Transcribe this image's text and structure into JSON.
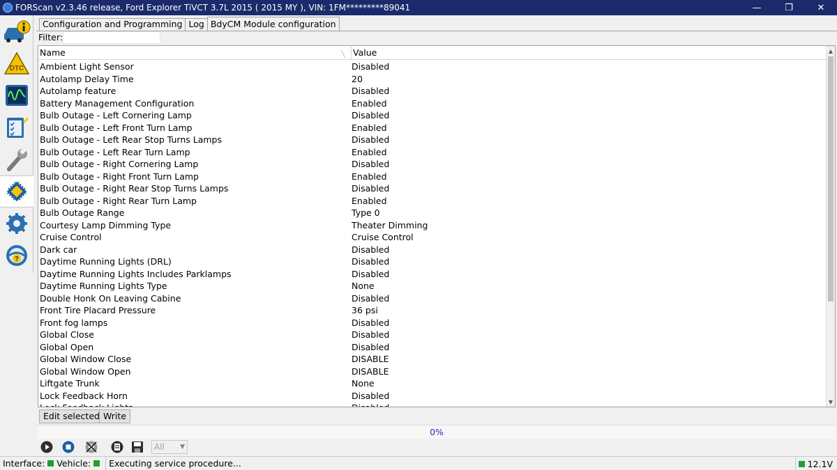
{
  "window": {
    "title": "FORScan v2.3.46 release, Ford Explorer TiVCT 3.7L 2015 ( 2015 MY ), VIN: 1FM*********89041",
    "minimize_glyph": "—",
    "maximize_glyph": "❐",
    "close_glyph": "✕"
  },
  "left_toolbar": {
    "items": [
      {
        "name": "vehicle-info-icon",
        "label": ""
      },
      {
        "name": "dtc-icon",
        "label": "DTC"
      },
      {
        "name": "oscilloscope-icon",
        "label": ""
      },
      {
        "name": "checklist-icon",
        "label": ""
      },
      {
        "name": "wrench-icon",
        "label": ""
      },
      {
        "name": "chip-icon",
        "label": ""
      },
      {
        "name": "gear-icon",
        "label": ""
      },
      {
        "name": "help-icon",
        "label": "?"
      }
    ],
    "active_index": 5
  },
  "tabs": [
    {
      "label": "Configuration and Programming"
    },
    {
      "label": "Log"
    },
    {
      "label": "BdyCM Module configuration"
    }
  ],
  "filter": {
    "label": "Filter:",
    "value": ""
  },
  "grid": {
    "columns": {
      "name": "Name",
      "value": "Value"
    },
    "rows": [
      {
        "name": "Ambient Light Sensor",
        "value": "Disabled"
      },
      {
        "name": "Autolamp Delay Time",
        "value": "20"
      },
      {
        "name": "Autolamp feature",
        "value": "Disabled"
      },
      {
        "name": "Battery Management Configuration",
        "value": "Enabled"
      },
      {
        "name": "Bulb Outage - Left Cornering Lamp",
        "value": "Disabled"
      },
      {
        "name": "Bulb Outage - Left Front Turn Lamp",
        "value": "Enabled"
      },
      {
        "name": "Bulb Outage - Left Rear Stop Turns Lamps",
        "value": "Disabled"
      },
      {
        "name": "Bulb Outage - Left Rear Turn Lamp",
        "value": "Enabled"
      },
      {
        "name": "Bulb Outage - Right Cornering Lamp",
        "value": "Disabled"
      },
      {
        "name": "Bulb Outage - Right Front Turn Lamp",
        "value": "Enabled"
      },
      {
        "name": "Bulb Outage - Right Rear Stop Turns Lamps",
        "value": "Disabled"
      },
      {
        "name": "Bulb Outage - Right Rear Turn Lamp",
        "value": "Enabled"
      },
      {
        "name": "Bulb Outage Range",
        "value": "Type 0"
      },
      {
        "name": "Courtesy Lamp Dimming Type",
        "value": "Theater Dimming"
      },
      {
        "name": "Cruise Control",
        "value": "Cruise Control"
      },
      {
        "name": "Dark car",
        "value": "Disabled"
      },
      {
        "name": "Daytime Running Lights (DRL)",
        "value": "Disabled"
      },
      {
        "name": "Daytime Running Lights Includes Parklamps",
        "value": "Disabled"
      },
      {
        "name": "Daytime Running Lights Type",
        "value": "None"
      },
      {
        "name": "Double Honk On Leaving Cabine",
        "value": "Disabled"
      },
      {
        "name": "Front Tire Placard Pressure",
        "value": "36 psi"
      },
      {
        "name": "Front fog lamps",
        "value": "Disabled"
      },
      {
        "name": "Global Close",
        "value": "Disabled"
      },
      {
        "name": "Global Open",
        "value": "Disabled"
      },
      {
        "name": "Global Window Close",
        "value": "DISABLE"
      },
      {
        "name": "Global Window Open",
        "value": "DISABLE"
      },
      {
        "name": "Liftgate Trunk",
        "value": "None"
      },
      {
        "name": "Lock Feedback Horn",
        "value": "Disabled"
      },
      {
        "name": "Lock Feedback Lights",
        "value": "Disabled"
      }
    ]
  },
  "actions": {
    "edit_selected": "Edit selected",
    "write": "Write"
  },
  "progress": {
    "text": "0%",
    "value": 0
  },
  "bottom_toolbar": {
    "combo_value": "All"
  },
  "statusbar": {
    "interface_label": "Interface:",
    "vehicle_label": "Vehicle:",
    "message": "Executing service procedure...",
    "voltage": "12.1V"
  },
  "colors": {
    "titlebar": "#1b2a6b",
    "led_green": "#1fa02e",
    "progress_text": "#2030c0"
  }
}
